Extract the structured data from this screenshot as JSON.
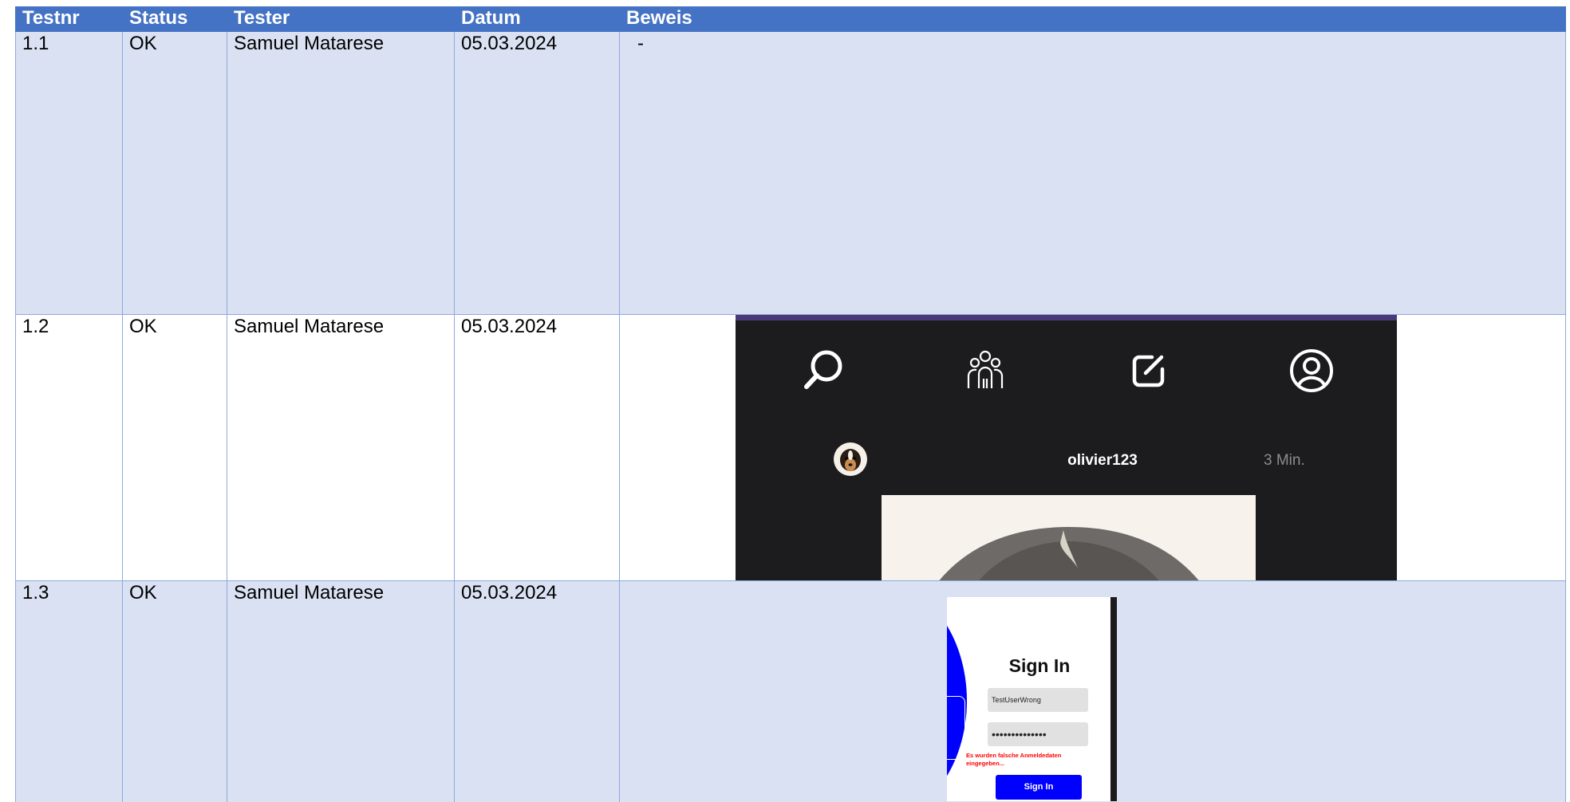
{
  "table": {
    "headers": {
      "testnr": "Testnr",
      "status": "Status",
      "tester": "Tester",
      "datum": "Datum",
      "beweis": "Beweis"
    },
    "rows": [
      {
        "testnr": "1.1",
        "status": "OK",
        "tester": "Samuel Matarese",
        "datum": "05.03.2024",
        "beweis": "-"
      },
      {
        "testnr": "1.2",
        "status": "OK",
        "tester": "Samuel Matarese",
        "datum": "05.03.2024",
        "beweis": ""
      },
      {
        "testnr": "1.3",
        "status": "OK",
        "tester": "Samuel Matarese",
        "datum": "05.03.2024",
        "beweis": ""
      }
    ]
  },
  "feed_screenshot": {
    "username": "olivier123",
    "time": "3 Min.",
    "icons": [
      "search-icon",
      "group-icon",
      "edit-icon",
      "profile-icon"
    ],
    "colors": {
      "background": "#1c1b1d",
      "topbar": "#4b3a78",
      "username": "#ffffff",
      "time": "#8d8d8d"
    }
  },
  "signin_screenshot": {
    "title": "Sign In",
    "username_value": "TestUserWrong",
    "password_value": "••••••••••••••",
    "error_message": "Es wurden falsche Anmeldedaten eingegeben...",
    "button_label": "Sign In",
    "colors": {
      "accent": "#0000ff",
      "error": "#ff0000"
    }
  },
  "colors": {
    "header_bg": "#4472c4",
    "shaded_row": "#d9e1f2",
    "border": "#8eaadb"
  }
}
